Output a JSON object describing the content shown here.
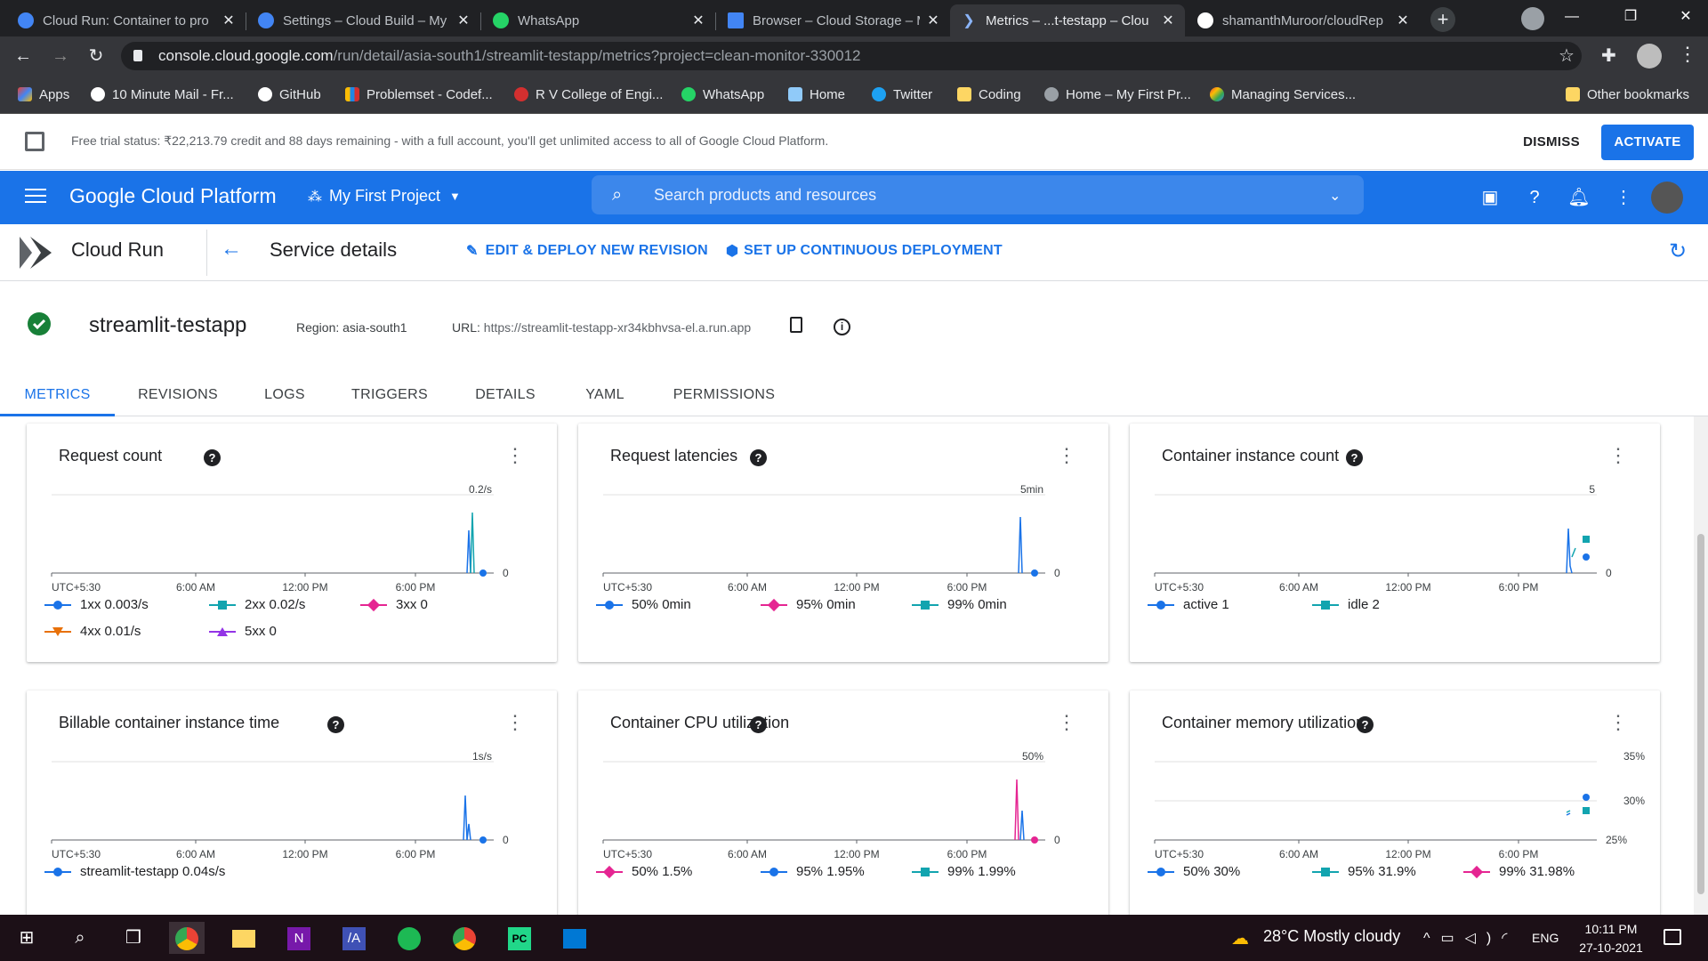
{
  "browser": {
    "tabs": [
      {
        "title": "Cloud Run: Container to pro",
        "fav": "#4285f4"
      },
      {
        "title": "Settings – Cloud Build – My",
        "fav": "#4285f4"
      },
      {
        "title": "WhatsApp",
        "fav": "#25d366"
      },
      {
        "title": "Browser – Cloud Storage – M",
        "fav": "#4285f4"
      },
      {
        "title": "Metrics – ...t-testapp – Clou",
        "fav": "#4285f4"
      },
      {
        "title": "shamanthMuroor/cloudRep",
        "fav": "#ffffff"
      }
    ],
    "url_host": "console.cloud.google.com",
    "url_path": "/run/detail/asia-south1/streamlit-testapp/metrics?project=clean-monitor-330012",
    "bookmarks": [
      {
        "label": "Apps",
        "color": "#ea4335"
      },
      {
        "label": "10 Minute Mail - Fr...",
        "color": "#ffffff"
      },
      {
        "label": "GitHub",
        "color": "#ffffff"
      },
      {
        "label": "Problemset - Codef...",
        "color": "#1e88e5"
      },
      {
        "label": "R V College of Engi...",
        "color": "#d32f2f"
      },
      {
        "label": "WhatsApp",
        "color": "#25d366"
      },
      {
        "label": "Home",
        "color": "#90caf9"
      },
      {
        "label": "Twitter",
        "color": "#1da1f2"
      },
      {
        "label": "Coding",
        "color": "#fdd663"
      },
      {
        "label": "Home – My First Pr...",
        "color": "#9aa0a6"
      },
      {
        "label": "Managing Services...",
        "color": "#4285f4"
      },
      {
        "label": "Other bookmarks",
        "color": "#fdd663"
      }
    ]
  },
  "banner": {
    "text": "Free trial status: ₹22,213.79 credit and 88 days remaining - with a full account, you'll get unlimited access to all of Google Cloud Platform.",
    "dismiss": "DISMISS",
    "activate": "ACTIVATE"
  },
  "header": {
    "brand": "Google Cloud Platform",
    "project": "My First Project",
    "search_placeholder": "Search products and resources"
  },
  "subheader": {
    "product": "Cloud Run",
    "page": "Service details",
    "edit": "EDIT & DEPLOY NEW REVISION",
    "cd": "SET UP CONTINUOUS DEPLOYMENT"
  },
  "service": {
    "name": "streamlit-testapp",
    "region": "Region: asia-south1",
    "url_label": "URL:",
    "url": "https://streamlit-testapp-xr34kbhvsa-el.a.run.app"
  },
  "tabs": [
    "METRICS",
    "REVISIONS",
    "LOGS",
    "TRIGGERS",
    "DETAILS",
    "YAML",
    "PERMISSIONS"
  ],
  "colors": {
    "blue": "#1a73e8",
    "teal": "#12a4af",
    "pink": "#e52592",
    "orange": "#e8710a",
    "purple": "#9334e6"
  },
  "charts": [
    {
      "title": "Request count",
      "yTop": "0.2/s",
      "yBottom": "0",
      "xTicks": [
        "UTC+5:30",
        "6:00 AM",
        "12:00 PM",
        "6:00 PM"
      ],
      "legend": [
        {
          "label": "1xx",
          "value": "0.003/s",
          "color": "#1a73e8",
          "marker": "circle"
        },
        {
          "label": "2xx",
          "value": "0.02/s",
          "color": "#12a4af",
          "marker": "square"
        },
        {
          "label": "3xx",
          "value": "0",
          "color": "#e52592",
          "marker": "diamond"
        },
        {
          "label": "4xx",
          "value": "0.01/s",
          "color": "#e8710a",
          "marker": "tri-down"
        },
        {
          "label": "5xx",
          "value": "0",
          "color": "#9334e6",
          "marker": "tri-up"
        }
      ]
    },
    {
      "title": "Request latencies",
      "yTop": "5min",
      "yBottom": "0",
      "xTicks": [
        "UTC+5:30",
        "6:00 AM",
        "12:00 PM",
        "6:00 PM"
      ],
      "legend": [
        {
          "label": "50%",
          "value": "0min",
          "color": "#1a73e8",
          "marker": "circle"
        },
        {
          "label": "95%",
          "value": "0min",
          "color": "#e52592",
          "marker": "diamond"
        },
        {
          "label": "99%",
          "value": "0min",
          "color": "#12a4af",
          "marker": "square"
        }
      ]
    },
    {
      "title": "Container instance count",
      "yTop": "5",
      "yBottom": "0",
      "xTicks": [
        "UTC+5:30",
        "6:00 AM",
        "12:00 PM",
        "6:00 PM"
      ],
      "legend": [
        {
          "label": "active",
          "value": "1",
          "color": "#1a73e8",
          "marker": "circle"
        },
        {
          "label": "idle",
          "value": "2",
          "color": "#12a4af",
          "marker": "square"
        }
      ]
    },
    {
      "title": "Billable container instance time",
      "yTop": "1s/s",
      "yBottom": "0",
      "xTicks": [
        "UTC+5:30",
        "6:00 AM",
        "12:00 PM",
        "6:00 PM"
      ],
      "legend": [
        {
          "label": "streamlit-testapp",
          "value": "0.04s/s",
          "color": "#1a73e8",
          "marker": "circle"
        }
      ]
    },
    {
      "title": "Container CPU utilization",
      "yTop": "50%",
      "yBottom": "0",
      "xTicks": [
        "UTC+5:30",
        "6:00 AM",
        "12:00 PM",
        "6:00 PM"
      ],
      "legend": [
        {
          "label": "50%",
          "value": "1.5%",
          "color": "#e52592",
          "marker": "diamond"
        },
        {
          "label": "95%",
          "value": "1.95%",
          "color": "#1a73e8",
          "marker": "circle"
        },
        {
          "label": "99%",
          "value": "1.99%",
          "color": "#12a4af",
          "marker": "square"
        }
      ]
    },
    {
      "title": "Container memory utilization",
      "yTop": "35%",
      "yMid": "30%",
      "yBottom": "25%",
      "xTicks": [
        "UTC+5:30",
        "6:00 AM",
        "12:00 PM",
        "6:00 PM"
      ],
      "legend": [
        {
          "label": "50%",
          "value": "30%",
          "color": "#1a73e8",
          "marker": "circle"
        },
        {
          "label": "95%",
          "value": "31.9%",
          "color": "#12a4af",
          "marker": "square"
        },
        {
          "label": "99%",
          "value": "31.98%",
          "color": "#e52592",
          "marker": "diamond"
        }
      ]
    }
  ],
  "taskbar": {
    "weather": "28°C  Mostly cloudy",
    "lang": "ENG",
    "time": "10:11 PM",
    "date": "27-10-2021"
  }
}
